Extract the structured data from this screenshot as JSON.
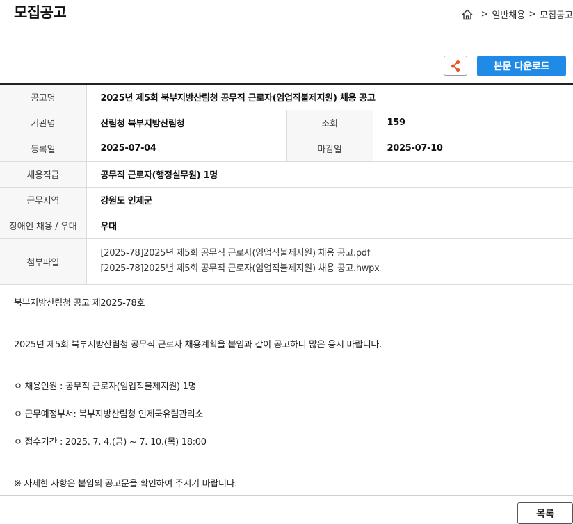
{
  "page_title": "모집공고",
  "breadcrumb": {
    "items": [
      "일반채용",
      "모집공고"
    ],
    "separator": ">"
  },
  "actions": {
    "download_label": "본문 다운로드"
  },
  "info": {
    "title_label": "공고명",
    "title_value": "2025년 제5회 북부지방산림청 공무직 근로자(임업직불제지원) 채용 공고",
    "org_label": "기관명",
    "org_value": "산림청 북부지방산림청",
    "views_label": "조회",
    "views_value": "159",
    "reg_label": "등록일",
    "reg_value": "2025-07-04",
    "deadline_label": "마감일",
    "deadline_value": "2025-07-10",
    "grade_label": "채용직급",
    "grade_value": "공무직 근로자(행정실무원) 1명",
    "region_label": "근무지역",
    "region_value": "강원도 인제군",
    "disabled_label": "장애인 채용 / 우대",
    "disabled_value": "우대",
    "files_label": "첨부파일",
    "files": [
      "[2025-78]2025년 제5회 공무직 근로자(임업직불제지원) 채용 공고.pdf",
      "[2025-78]2025년 제5회 공무직 근로자(임업직불제지원) 채용 공고.hwpx"
    ]
  },
  "content": {
    "lines": [
      "북부지방산림청 공고 제2025-78호",
      "2025년 제5회 북부지방산림청 공무직 근로자 채용계획을 붙임과 같이 공고하니 많은 응시 바랍니다.",
      "ㅇ 채용인원 : 공무직 근로자(임업직불제지원) 1명",
      "ㅇ 근무예정부서: 북부지방산림청 인제국유림관리소",
      "ㅇ 접수기간 : 2025. 7. 4.(금) ~ 7. 10.(목) 18:00",
      "※ 자세한 사항은 붙임의 공고문을 확인하여 주시기 바랍니다."
    ]
  },
  "footer": {
    "list_label": "목록"
  },
  "colors": {
    "accent": "#1f8be6",
    "share_icon": "#e8542a"
  },
  "icons": {
    "home": "home-icon",
    "share": "share-icon"
  }
}
